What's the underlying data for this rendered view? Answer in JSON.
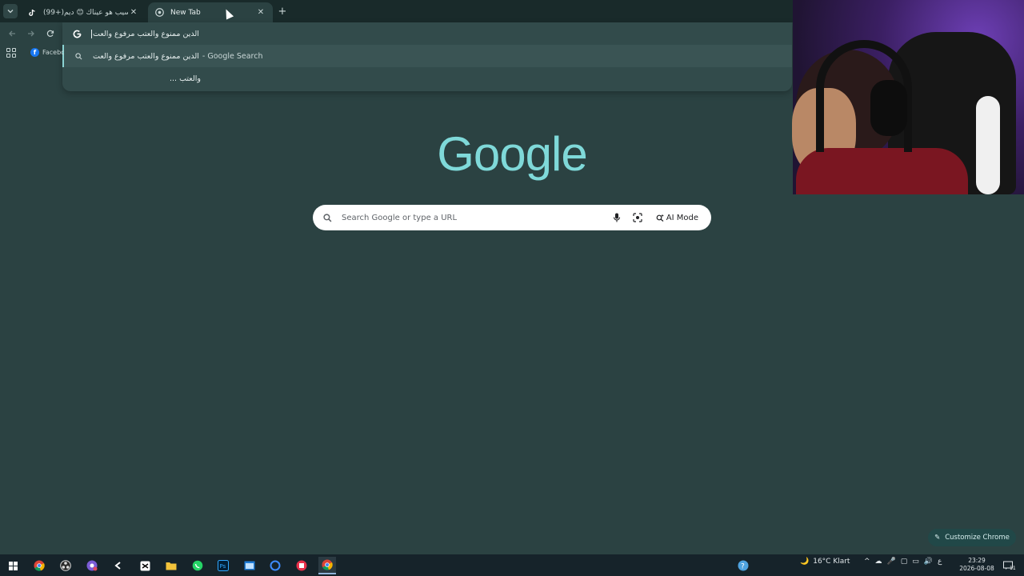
{
  "tabs": [
    {
      "title": "(99+)السيب هو عيناك 😊 ديم...",
      "favicon": "tiktok-icon"
    },
    {
      "title": "New Tab",
      "favicon": "chrome-icon"
    }
  ],
  "omnibox": {
    "input_value": "الدين ممنوع والعتب مرفوع والعت",
    "suggestions": [
      {
        "text": "الدين ممنوع والعتب مرفوع والعت",
        "suffix": "- Google Search"
      },
      {
        "text": "... والعتب",
        "suffix": ""
      }
    ]
  },
  "bookmarks": {
    "facebook_label": "Facebc"
  },
  "google": {
    "logo": "Google",
    "search_placeholder": "Search Google or type a URL",
    "ai_mode_label": "AI Mode"
  },
  "customize_label": "Customize Chrome",
  "taskbar": {
    "weather": "16°C  Klart",
    "lang": "ع",
    "time": "23:29",
    "date": "2026-08-08",
    "notif_count": "11"
  },
  "colors": {
    "background": "#2b4242",
    "accent": "#7fd9d9",
    "tabstrip": "#192a2a"
  }
}
